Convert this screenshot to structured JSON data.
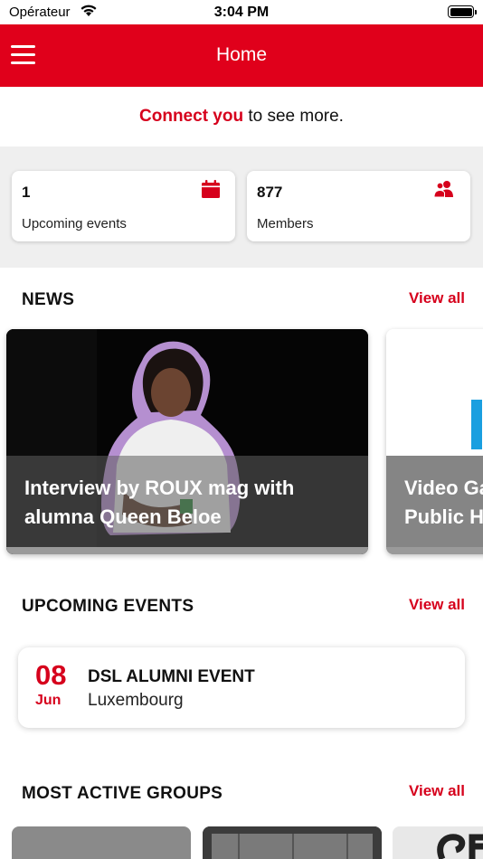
{
  "status_bar": {
    "carrier": "Opérateur",
    "time": "3:04 PM"
  },
  "header": {
    "title": "Home",
    "menu_icon": "hamburger-menu-icon",
    "background_color": "#e0001b"
  },
  "connect_banner": {
    "link_text": "Connect you",
    "rest_text": " to see more."
  },
  "stats": [
    {
      "value": "1",
      "label": "Upcoming events",
      "icon": "calendar-icon"
    },
    {
      "value": "877",
      "label": "Members",
      "icon": "members-icon"
    }
  ],
  "news": {
    "title": "NEWS",
    "view_all": "View all",
    "items": [
      {
        "title": "Interview by ROUX mag with alumna Queen Beloe"
      },
      {
        "title": "Video Ga",
        "title_line2": "Public H"
      }
    ]
  },
  "events": {
    "title": "UPCOMING EVENTS",
    "view_all": "View all",
    "items": [
      {
        "day": "08",
        "month": "Jun",
        "name": "DSL ALUMNI EVENT",
        "location": "Luxembourg"
      }
    ]
  },
  "groups": {
    "title": "MOST ACTIVE GROUPS",
    "view_all": "View all"
  },
  "colors": {
    "accent": "#d6001c",
    "stats_background": "#efefef"
  }
}
